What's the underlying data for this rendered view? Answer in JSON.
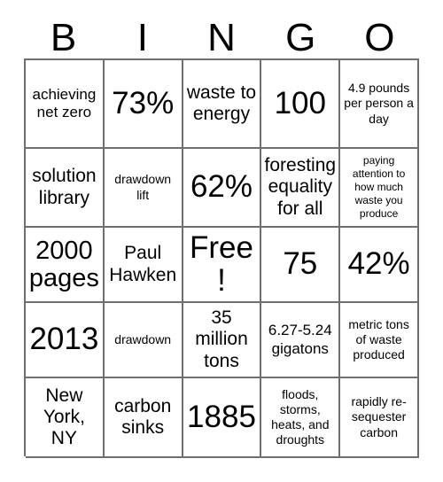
{
  "card": {
    "title_letters": [
      "B",
      "I",
      "N",
      "G",
      "O"
    ],
    "columns": 5,
    "rows": 5,
    "free_space_label": "Free!",
    "grid_line_color": "#6f6f6f",
    "background_color": "#ffffff",
    "text_color": "#000000"
  },
  "cells": [
    [
      {
        "text": "achieving net zero",
        "size": "sm"
      },
      {
        "text": "73%",
        "size": "xl"
      },
      {
        "text": "waste to energy",
        "size": "md"
      },
      {
        "text": "100",
        "size": "xl"
      },
      {
        "text": "4.9 pounds per person a day",
        "size": "xs"
      }
    ],
    [
      {
        "text": "solution library",
        "size": "md"
      },
      {
        "text": "drawdown lift",
        "size": "xs"
      },
      {
        "text": "62%",
        "size": "xl"
      },
      {
        "text": "foresting equality for all",
        "size": "md"
      },
      {
        "text": "paying attention to how much waste you produce",
        "size": "xxs"
      }
    ],
    [
      {
        "text": "2000 pages",
        "size": "lg"
      },
      {
        "text": "Paul Hawken",
        "size": "md"
      },
      {
        "text": "Free!",
        "size": "xl"
      },
      {
        "text": "75",
        "size": "xl"
      },
      {
        "text": "42%",
        "size": "xl"
      }
    ],
    [
      {
        "text": "2013",
        "size": "xl"
      },
      {
        "text": "drawdown",
        "size": "xs"
      },
      {
        "text": "35 million tons",
        "size": "md"
      },
      {
        "text": "6.27-5.24 gigatons",
        "size": "sm"
      },
      {
        "text": "metric tons of waste produced",
        "size": "xs"
      }
    ],
    [
      {
        "text": "New York, NY",
        "size": "md"
      },
      {
        "text": "carbon sinks",
        "size": "md"
      },
      {
        "text": "1885",
        "size": "xl"
      },
      {
        "text": "floods, storms, heats, and droughts",
        "size": "xs"
      },
      {
        "text": "rapidly re-sequester carbon",
        "size": "xs"
      }
    ]
  ]
}
